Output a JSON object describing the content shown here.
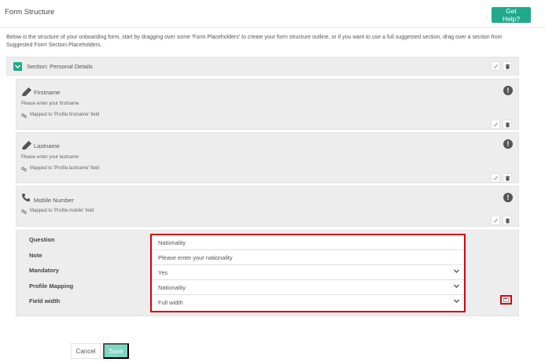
{
  "header": {
    "title": "Form Structure",
    "help_label": "Get Help?"
  },
  "intro_text": "Below is the structure of your onboarding form, start by dragging over some 'Form Placeholders' to create your form structure outline, or if you want to use a full suggested section, drag over a section from Suggested Form Section Placeholders.",
  "section": {
    "label": "Section: Personal Details"
  },
  "fields": [
    {
      "title": "Firstname",
      "placeholder": "Please enter your firstname",
      "mapping": "Mapped to 'Profile.firstname' field",
      "icon": "pencil-icon"
    },
    {
      "title": "Lastname",
      "placeholder": "Please enter your lastname",
      "mapping": "Mapped to 'Profile.lastname' field",
      "icon": "pencil-icon"
    },
    {
      "title": "Mobile Number",
      "mapping": "Mapped to 'Profile.mobile' field",
      "icon": "phone-icon"
    }
  ],
  "editor": {
    "labels": {
      "question": "Question",
      "note": "Note",
      "mandatory": "Mandatory",
      "profile_mapping": "Profile Mapping",
      "field_width": "Field width"
    },
    "values": {
      "question": "Nationality",
      "note": "Please enter your nationality",
      "mandatory": "Yes",
      "profile_mapping": "Nationality",
      "field_width": "Full width"
    }
  },
  "footer": {
    "cancel_label": "Cancel",
    "save_label": "Save"
  },
  "colors": {
    "accent": "#1faa8c",
    "save_disabled": "#7ed6c2",
    "highlight": "#d8000c"
  }
}
